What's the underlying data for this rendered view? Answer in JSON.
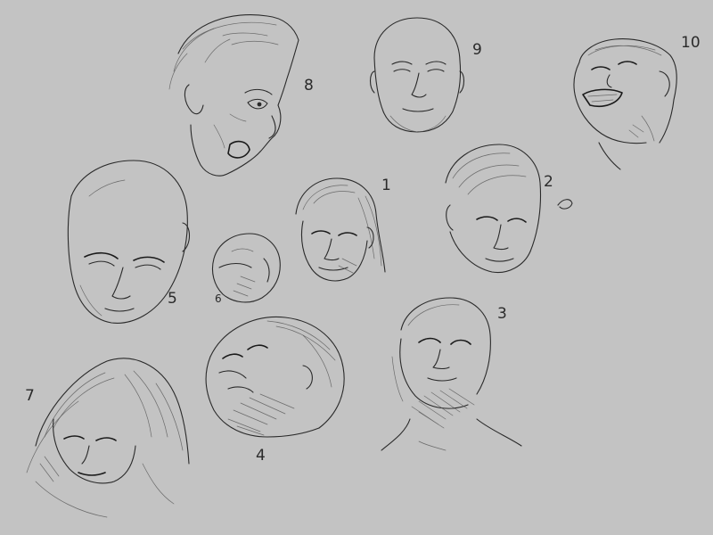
{
  "sketch_labels": {
    "s1": "1",
    "s2": "2",
    "s3": "3",
    "s4": "4",
    "s5": "5",
    "s6": "6",
    "s7": "7",
    "s8": "8",
    "s9": "9",
    "s10": "10"
  },
  "colors": {
    "background": "#c3c3c3",
    "ink": "#2a2a2a"
  }
}
